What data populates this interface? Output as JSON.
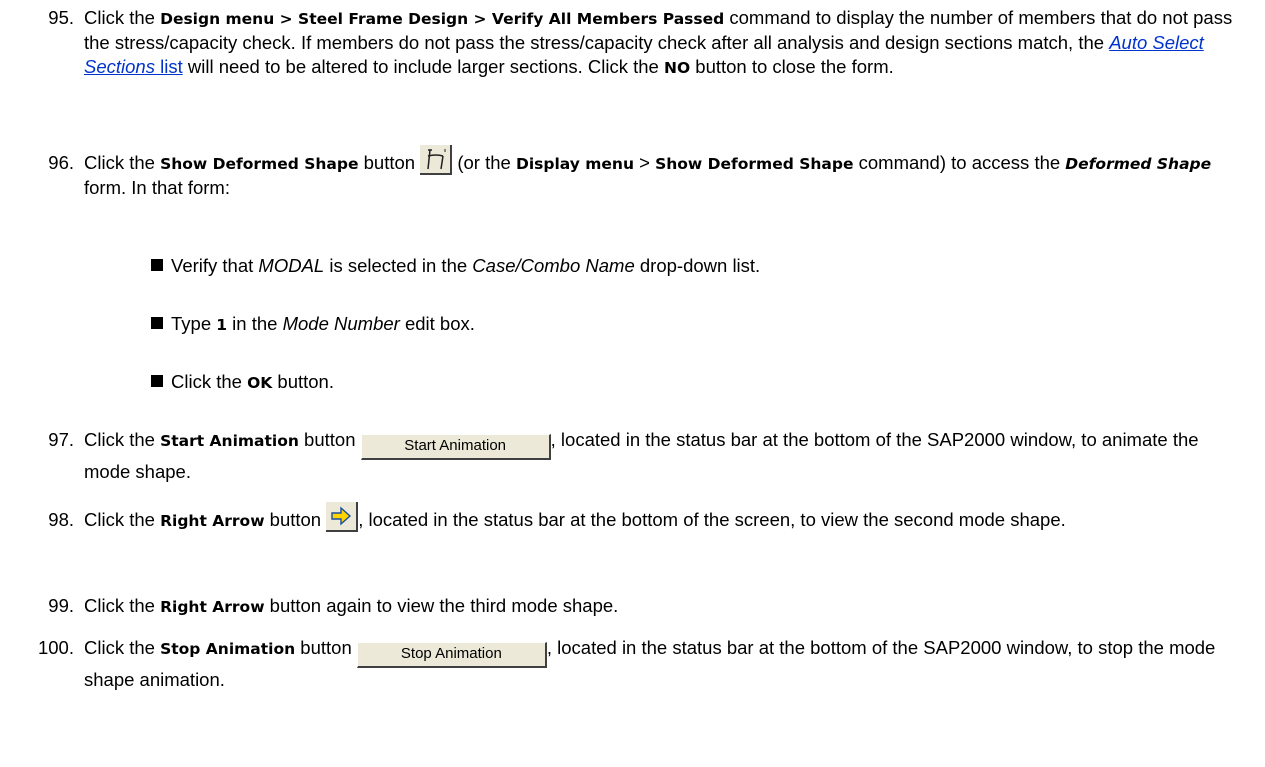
{
  "steps": {
    "s95": {
      "num": "95.",
      "t1": "Click the ",
      "ui1": "Design menu > Steel Frame Design > Verify All Members Passed",
      "t2": " command to display the number of members that do not pass the stress/capacity check. If members do not pass the stress/capacity check after all analysis and design sections match, the ",
      "link_italic": "Auto Select Sections",
      "link_plain": " list",
      "t3": " will need to be altered to include larger sections. Click the ",
      "ui2": "NO",
      "t4": " button to close the form."
    },
    "s96": {
      "num": "96.",
      "t1": "Click the ",
      "ui1": "Show Deformed Shape",
      "t2": " button ",
      "t3": " (or the ",
      "ui2": "Display menu",
      "t4": " > ",
      "ui3": "Show Deformed Shape",
      "t5": " command) to access the ",
      "form_name": "Deformed Shape",
      "t6": " form. In that form:"
    },
    "bullets": {
      "b1": {
        "t1": "Verify that ",
        "i1": "MODAL",
        "t2": " is selected in the ",
        "i2": "Case/Combo Name",
        "t3": " drop-down list."
      },
      "b2": {
        "t1": "Type ",
        "v": "1",
        "t2": " in the ",
        "i1": "Mode Number",
        "t3": " edit box."
      },
      "b3": {
        "t1": "Click the ",
        "ui": "OK",
        "t2": " button."
      }
    },
    "s97": {
      "num": "97.",
      "t1": "Click the ",
      "ui1": "Start Animation",
      "t2": " button ",
      "btn": "Start Animation",
      "t3": ", located in the status bar at the bottom of the SAP2000 window, to animate the mode shape."
    },
    "s98": {
      "num": "98.",
      "t1": "Click the ",
      "ui1": "Right Arrow",
      "t2": " button ",
      "t3": ", located in the status bar at the bottom of the screen, to view the second mode shape."
    },
    "s99": {
      "num": "99.",
      "t1": "Click the ",
      "ui1": "Right Arrow",
      "t2": " button again to view the third mode shape."
    },
    "s100": {
      "num": "100.",
      "t1": "Click the ",
      "ui1": "Stop Animation",
      "t2": " button ",
      "btn": "Stop Animation",
      "t3": ", located in the status bar at the bottom of the SAP2000 window, to stop the mode shape animation."
    }
  },
  "icons": {
    "deformed_shape": "deformed-shape-icon",
    "right_arrow": "right-arrow-icon",
    "bullet": "square-bullet-icon"
  },
  "colors": {
    "link": "#0033cc",
    "button_face": "#ece9d8",
    "arrow": "#ffd400"
  }
}
